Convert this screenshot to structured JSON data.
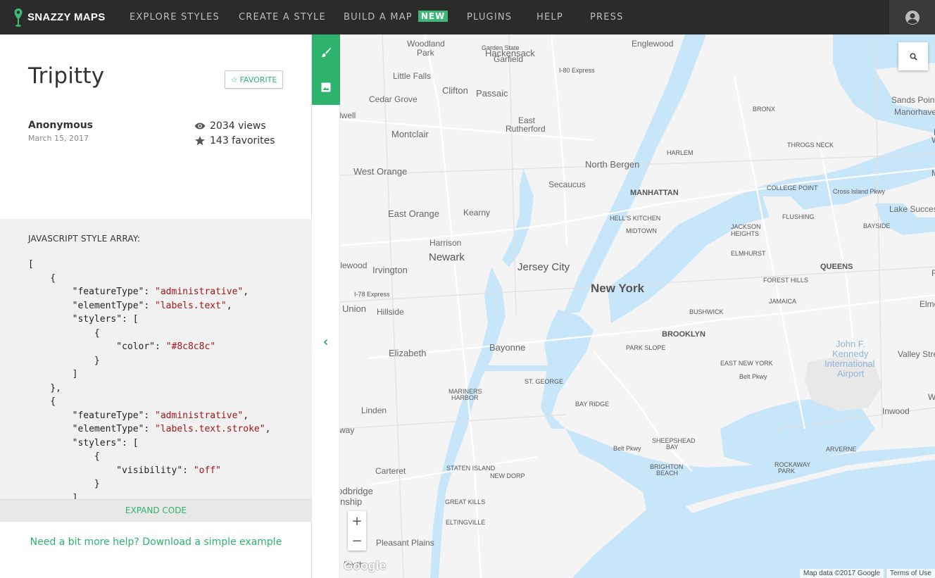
{
  "brand": {
    "name": "SNAZZY MAPS",
    "accent": "#3cb878",
    "nav_bg": "#2b2b2b"
  },
  "nav": {
    "items": [
      {
        "label": "EXPLORE STYLES"
      },
      {
        "label": "CREATE A STYLE"
      },
      {
        "label": "BUILD A MAP",
        "badge": "NEW"
      },
      {
        "label": "PLUGINS"
      },
      {
        "label": "HELP"
      },
      {
        "label": "PRESS"
      }
    ],
    "account_icon": "user-circle-icon"
  },
  "style": {
    "title": "Tripitty",
    "favorite_label": "FAVORITE",
    "author": "Anonymous",
    "date": "March 15, 2017",
    "views": "2034 views",
    "favorites": "143 favorites"
  },
  "code": {
    "label": "JAVASCRIPT STYLE ARRAY:",
    "lines": [
      "[",
      "    {",
      "        \"featureType\": \"administrative\",",
      "        \"elementType\": \"labels.text\",",
      "        \"stylers\": [",
      "            {",
      "                \"color\": \"#8c8c8c\"",
      "            }",
      "        ]",
      "    },",
      "    {",
      "        \"featureType\": \"administrative\",",
      "        \"elementType\": \"labels.text.stroke\",",
      "        \"stylers\": [",
      "            {",
      "                \"visibility\": \"off\"",
      "            }",
      "        ]"
    ],
    "expand_label": "EXPAND CODE"
  },
  "help_text": "Need a bit more help? Download a simple example",
  "map": {
    "water_color": "#c8e6fa",
    "land_color": "#f4f4f4",
    "labels": [
      {
        "text": "Woodland",
        "size": "s"
      },
      {
        "text": "Park",
        "size": "s"
      },
      {
        "text": "Garden State",
        "size": "xs"
      },
      {
        "text": "Hackensack",
        "size": "m"
      },
      {
        "text": "Englewood",
        "size": "s"
      },
      {
        "text": "Garfield",
        "size": "s"
      },
      {
        "text": "I-80 Express",
        "size": "xs"
      },
      {
        "text": "Little Falls",
        "size": "s"
      },
      {
        "text": "Clifton",
        "size": "m"
      },
      {
        "text": "Passaic",
        "size": "m"
      },
      {
        "text": "Cedar Grove",
        "size": "s"
      },
      {
        "text": "Caldwell",
        "size": "s"
      },
      {
        "text": "East",
        "size": "s"
      },
      {
        "text": "Rutherford",
        "size": "s"
      },
      {
        "text": "Montclair",
        "size": "m"
      },
      {
        "text": "BRONX",
        "size": "xs"
      },
      {
        "text": "Sands Point",
        "size": "s"
      },
      {
        "text": "Manorhaven",
        "size": "s"
      },
      {
        "text": "Po",
        "size": "s"
      },
      {
        "text": "Washi",
        "size": "s"
      },
      {
        "text": "THROGS NECK",
        "size": "xs"
      },
      {
        "text": "HARLEM",
        "size": "xs"
      },
      {
        "text": "North Bergen",
        "size": "m"
      },
      {
        "text": "West Orange",
        "size": "m"
      },
      {
        "text": "Secaucus",
        "size": "s"
      },
      {
        "text": "Manha",
        "size": "s"
      },
      {
        "text": "MANHATTAN",
        "size": "xs-b"
      },
      {
        "text": "COLLEGE POINT",
        "size": "xs"
      },
      {
        "text": "Cross Island Pkwy",
        "size": "xs"
      },
      {
        "text": "East Orange",
        "size": "m"
      },
      {
        "text": "Kearny",
        "size": "s"
      },
      {
        "text": "HELL'S KITCHEN",
        "size": "xs"
      },
      {
        "text": "FLUSHING",
        "size": "xs"
      },
      {
        "text": "Lake Success",
        "size": "s"
      },
      {
        "text": "JACKSON",
        "size": "xs"
      },
      {
        "text": "HEIGHTS",
        "size": "xs"
      },
      {
        "text": "MIDTOWN",
        "size": "xs"
      },
      {
        "text": "BAYSIDE",
        "size": "xs"
      },
      {
        "text": "Harrison",
        "size": "s"
      },
      {
        "text": "ELMHURST",
        "size": "xs"
      },
      {
        "text": "Newark",
        "size": "l"
      },
      {
        "text": "Maplewood",
        "size": "s"
      },
      {
        "text": "Irvington",
        "size": "m"
      },
      {
        "text": "Jersey City",
        "size": "l"
      },
      {
        "text": "QUEENS",
        "size": "xs-b"
      },
      {
        "text": "Floral P",
        "size": "s"
      },
      {
        "text": "FOREST HILLS",
        "size": "xs"
      },
      {
        "text": "New York",
        "size": "xl"
      },
      {
        "text": "I-78 Express",
        "size": "xs"
      },
      {
        "text": "Union",
        "size": "m"
      },
      {
        "text": "Hillside",
        "size": "s"
      },
      {
        "text": "BUSHWICK",
        "size": "xs"
      },
      {
        "text": "JAMAICA",
        "size": "xs"
      },
      {
        "text": "Elmont",
        "size": "s"
      },
      {
        "text": "BROOKLYN",
        "size": "xs-b"
      },
      {
        "text": "John F.",
        "size": "m-air"
      },
      {
        "text": "Kennedy",
        "size": "m-air"
      },
      {
        "text": "International",
        "size": "m-air"
      },
      {
        "text": "Airport",
        "size": "m-air"
      },
      {
        "text": "Bayonne",
        "size": "m"
      },
      {
        "text": "PARK SLOPE",
        "size": "xs"
      },
      {
        "text": "Elizabeth",
        "size": "m"
      },
      {
        "text": "Valley Stre",
        "size": "s"
      },
      {
        "text": "EAST NEW YORK",
        "size": "xs"
      },
      {
        "text": "ST. GEORGE",
        "size": "xs"
      },
      {
        "text": "Belt Pkwy",
        "size": "xs"
      },
      {
        "text": "MARINERS",
        "size": "xs"
      },
      {
        "text": "HARBOR",
        "size": "xs"
      },
      {
        "text": "Woodmer",
        "size": "s"
      },
      {
        "text": "BAY RIDGE",
        "size": "xs"
      },
      {
        "text": "Inwood",
        "size": "s"
      },
      {
        "text": "Linden",
        "size": "s"
      },
      {
        "text": "Rahway",
        "size": "s"
      },
      {
        "text": "Belt Pkwy",
        "size": "xs"
      },
      {
        "text": "SHEEPSHEAD",
        "size": "xs"
      },
      {
        "text": "BAY",
        "size": "xs"
      },
      {
        "text": "ARVERNE",
        "size": "xs"
      },
      {
        "text": "Carteret",
        "size": "s"
      },
      {
        "text": "STATEN ISLAND",
        "size": "xs"
      },
      {
        "text": "BRIGHTON",
        "size": "xs"
      },
      {
        "text": "BEACH",
        "size": "xs"
      },
      {
        "text": "ROCKAWAY",
        "size": "xs"
      },
      {
        "text": "PARK",
        "size": "xs"
      },
      {
        "text": "NEW DORP",
        "size": "xs"
      },
      {
        "text": "Woodbridge",
        "size": "m"
      },
      {
        "text": "Township",
        "size": "m"
      },
      {
        "text": "GREAT KILLS",
        "size": "xs"
      },
      {
        "text": "ELTINGVILLE",
        "size": "xs"
      },
      {
        "text": "Pleasant Plains",
        "size": "s"
      },
      {
        "text": "Perth",
        "size": "s"
      }
    ],
    "zoom_in": "+",
    "zoom_out": "−",
    "google": "Google",
    "attribution": "Map data ©2017 Google",
    "terms": "Terms of Use"
  }
}
